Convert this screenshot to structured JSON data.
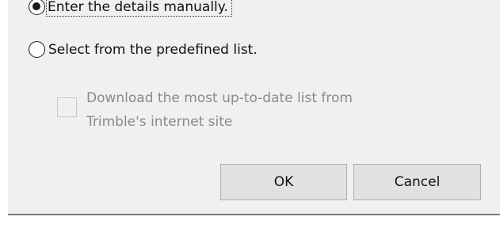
{
  "options": {
    "manual_label": "Enter the details manually.",
    "predefined_label": "Select from the predefined list.",
    "selected": "manual"
  },
  "download": {
    "line1": "Download the most up-to-date list from",
    "line2": "Trimble's internet site",
    "checked": false,
    "enabled": false
  },
  "buttons": {
    "ok_label": "OK",
    "cancel_label": "Cancel"
  }
}
